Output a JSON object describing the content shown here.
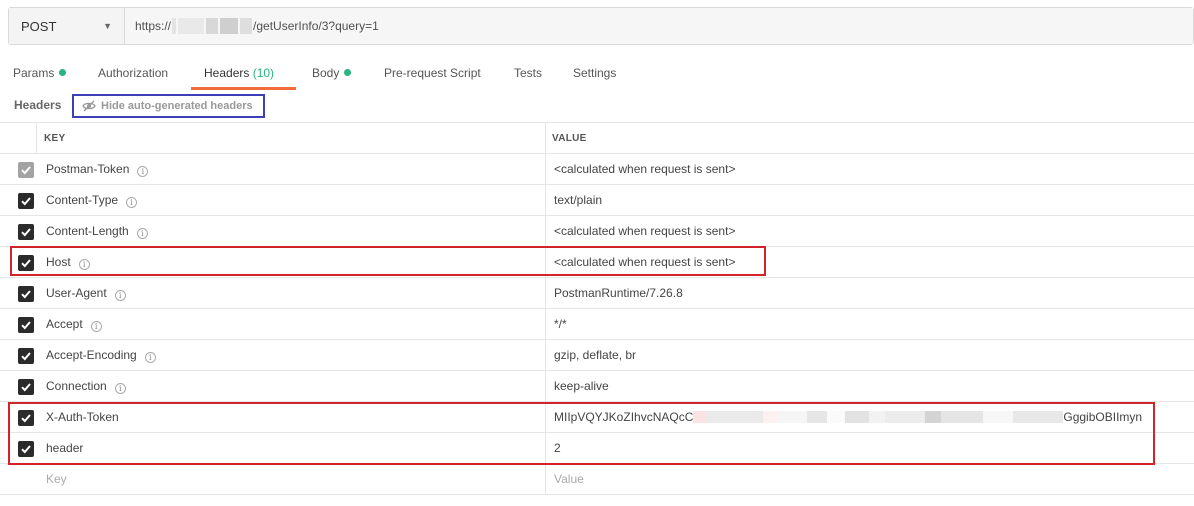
{
  "request": {
    "method": "POST",
    "url_prefix": "https://",
    "url_suffix": "/getUserInfo/3?query=1"
  },
  "tabs": [
    {
      "label": "Params",
      "dot": true
    },
    {
      "label": "Authorization",
      "dot": false
    },
    {
      "label": "Headers",
      "count": "(10)",
      "active": true
    },
    {
      "label": "Body",
      "dot": true
    },
    {
      "label": "Pre-request Script",
      "dot": false
    },
    {
      "label": "Tests",
      "dot": false
    },
    {
      "label": "Settings",
      "dot": false
    }
  ],
  "headers_section": {
    "label": "Headers",
    "hide_button": "Hide auto-generated headers"
  },
  "table": {
    "col_key": "KEY",
    "col_value": "VALUE",
    "rows": [
      {
        "key": "Postman-Token",
        "value": "<calculated when request is sent>",
        "info": true
      },
      {
        "key": "Content-Type",
        "value": "text/plain",
        "info": true
      },
      {
        "key": "Content-Length",
        "value": "<calculated when request is sent>",
        "info": true
      },
      {
        "key": "Host",
        "value": "<calculated when request is sent>",
        "info": true
      },
      {
        "key": "User-Agent",
        "value": "PostmanRuntime/7.26.8",
        "info": true
      },
      {
        "key": "Accept",
        "value": "*/*",
        "info": true
      },
      {
        "key": "Accept-Encoding",
        "value": "gzip, deflate, br",
        "info": true
      },
      {
        "key": "Connection",
        "value": "keep-alive",
        "info": true
      },
      {
        "key": "X-Auth-Token",
        "value_start": "MIIpVQYJKoZIhvcNAQcC",
        "value_end": "GggibOBIImyn",
        "info": false
      },
      {
        "key": "header",
        "value": "2",
        "info": false
      }
    ],
    "placeholder_key": "Key",
    "placeholder_value": "Value"
  },
  "colors": {
    "accent": "#f26b3a",
    "green": "#26b47f",
    "highlight_red": "#d2232a",
    "highlight_blue": "#3d3fb9"
  }
}
